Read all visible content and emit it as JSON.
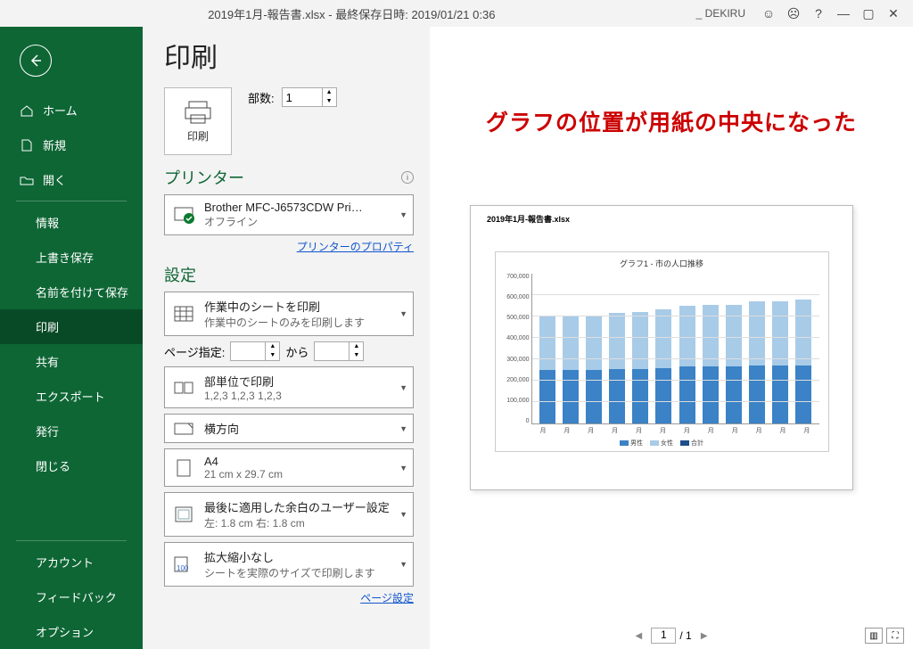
{
  "titlebar": {
    "title": "2019年1月-報告書.xlsx - 最終保存日時: 2019/01/21 0:36",
    "user": "_ DEKIRU"
  },
  "sidebar": {
    "home": "ホーム",
    "new": "新規",
    "open": "開く",
    "info": "情報",
    "save": "上書き保存",
    "saveas": "名前を付けて保存",
    "print": "印刷",
    "share": "共有",
    "export": "エクスポート",
    "publish": "発行",
    "close": "閉じる",
    "account": "アカウント",
    "feedback": "フィードバック",
    "options": "オプション"
  },
  "page": {
    "title": "印刷",
    "print_button": "印刷",
    "copies_label": "部数:",
    "copies_value": "1",
    "printer_header": "プリンター",
    "printer_name": "Brother MFC-J6573CDW Pri…",
    "printer_status": "オフライン",
    "printer_props": "プリンターのプロパティ",
    "settings_header": "設定",
    "s1_t": "作業中のシートを印刷",
    "s1_d": "作業中のシートのみを印刷します",
    "range_label": "ページ指定:",
    "range_to": "から",
    "s2_t": "部単位で印刷",
    "s2_d": "1,2,3    1,2,3    1,2,3",
    "s3": "横方向",
    "s4_t": "A4",
    "s4_d": "21 cm x 29.7 cm",
    "s5_t": "最後に適用した余白のユーザー設定",
    "s5_d": "左: 1.8 cm    右: 1.8 cm",
    "s6_t": "拡大縮小なし",
    "s6_d": "シートを実際のサイズで印刷します",
    "page_setup": "ページ設定"
  },
  "preview": {
    "annotation": "グラフの位置が用紙の中央になった",
    "doc_title": "2019年1月-報告書.xlsx",
    "page_cur": "1",
    "page_total": "/ 1"
  },
  "chart_data": {
    "type": "bar",
    "title": "グラフ1 - 市の人口推移",
    "xlabel": "月",
    "categories": [
      "月",
      "月",
      "月",
      "月",
      "月",
      "月",
      "月",
      "月",
      "月",
      "月",
      "月",
      "月"
    ],
    "ylim": [
      0,
      700000
    ],
    "yticks": [
      "700,000",
      "600,000",
      "500,000",
      "400,000",
      "300,000",
      "200,000",
      "100,000",
      "0"
    ],
    "series": [
      {
        "name": "男性",
        "color": "#3b82c6",
        "values": [
          250000,
          250000,
          250000,
          255000,
          255000,
          260000,
          265000,
          265000,
          265000,
          270000,
          270000,
          270000
        ]
      },
      {
        "name": "女性",
        "color": "#a8cbe8",
        "values": [
          250000,
          250000,
          250000,
          260000,
          265000,
          275000,
          285000,
          290000,
          290000,
          300000,
          300000,
          310000
        ]
      },
      {
        "name": "合計",
        "color": "#1e4e8c",
        "values": [
          500000,
          500000,
          500000,
          515000,
          520000,
          535000,
          550000,
          555000,
          555000,
          570000,
          570000,
          580000
        ]
      }
    ]
  }
}
